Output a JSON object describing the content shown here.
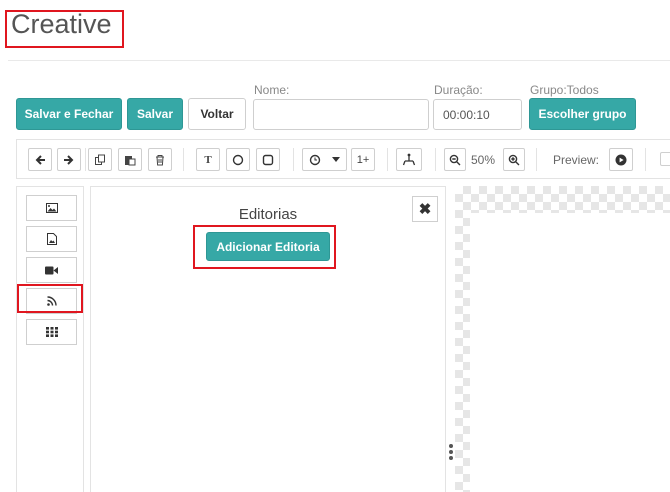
{
  "page": {
    "title": "Creative"
  },
  "actions": {
    "save_close": "Salvar e Fechar",
    "save": "Salvar",
    "back": "Voltar",
    "choose_group": "Escolher grupo"
  },
  "form": {
    "name_label": "Nome:",
    "name_value": "",
    "duration_label": "Duração:",
    "duration_value": "00:00:10",
    "group_label": "Grupo:Todos"
  },
  "toolbar": {
    "text_tool": "T",
    "duplicate_count": "1+",
    "zoom": "50%",
    "preview_label": "Preview:"
  },
  "sidebar": {
    "items": [
      {
        "icon": "image-icon"
      },
      {
        "icon": "image-file-icon"
      },
      {
        "icon": "video-icon"
      },
      {
        "icon": "rss-icon",
        "active": true
      },
      {
        "icon": "grid-icon"
      }
    ]
  },
  "panel": {
    "title": "Editorias",
    "add_button": "Adicionar Editoria",
    "close_symbol": "✖"
  },
  "colors": {
    "accent": "#36a8a6",
    "highlight": "#e0161f"
  }
}
